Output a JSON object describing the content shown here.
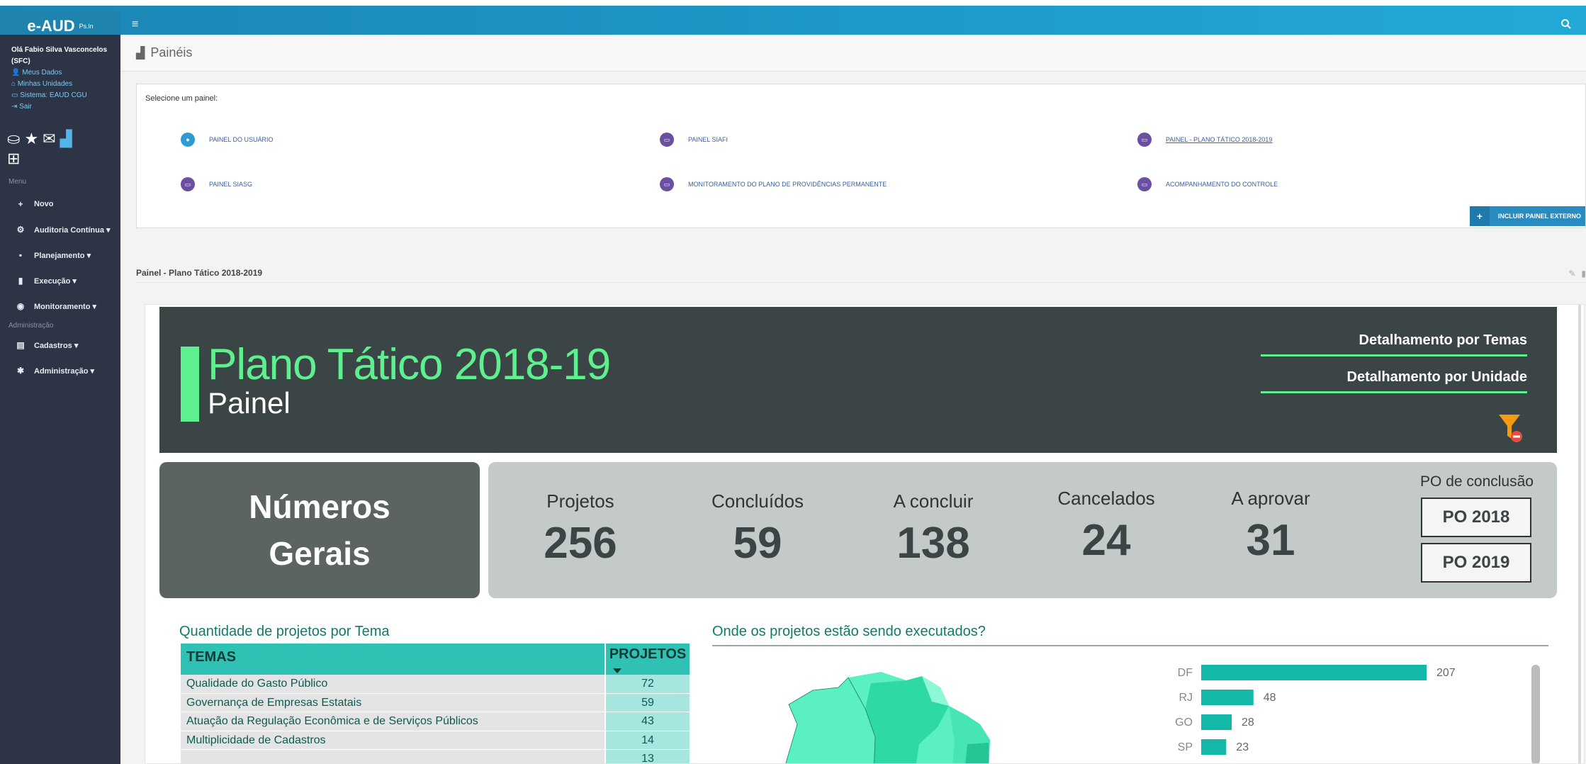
{
  "app": {
    "brand": "e-AUD",
    "brand_suffix": "Ps.ln"
  },
  "user": {
    "greeting": "Olá Fabio Silva Vasconcelos (SFC)",
    "links": [
      "Meus Dados",
      "Minhas Unidades",
      "Sistema: EAUD CGU",
      "Sair"
    ]
  },
  "sidebar": {
    "menu_title": "Menu",
    "items": [
      {
        "icon": "+",
        "label": "Novo"
      },
      {
        "icon": "⚙",
        "label": "Auditoria Contínua ▾"
      },
      {
        "icon": "▪",
        "label": "Planejamento ▾"
      },
      {
        "icon": "▮",
        "label": "Execução ▾"
      },
      {
        "icon": "◉",
        "label": "Monitoramento ▾"
      }
    ],
    "admin_title": "Administração",
    "admin_items": [
      {
        "icon": "▤",
        "label": "Cadastros ▾"
      },
      {
        "icon": "✱",
        "label": "Administração ▾"
      }
    ]
  },
  "page": {
    "title": "Painéis"
  },
  "panel_select": {
    "prompt": "Selecione um painel:",
    "panels": [
      "PAINEL DO USUÁRIO",
      "PAINEL SIAFI",
      "PAINEL - PLANO TÁTICO 2018-2019",
      "PAINEL SIASG",
      "MONITORAMENTO DO PLANO DE PROVIDÊNCIAS PERMANENTE",
      "ACOMPANHAMENTO DO CONTROLE"
    ],
    "add_button": "INCLUIR PAINEL EXTERNO"
  },
  "section": {
    "title": "Painel - Plano Tático 2018-2019"
  },
  "report": {
    "title": "Plano Tático 2018-19",
    "subtitle": "Painel",
    "links": [
      "Detalhamento por Temas",
      "Detalhamento por Unidade"
    ],
    "numeros_gerais_1": "Números",
    "numeros_gerais_2": "Gerais",
    "stats": [
      {
        "label": "Projetos",
        "value": "256"
      },
      {
        "label": "Concluídos",
        "value": "59"
      },
      {
        "label": "A concluir",
        "value": "138"
      },
      {
        "label": "Cancelados",
        "value": "24"
      },
      {
        "label": "A aprovar",
        "value": "31"
      }
    ],
    "po_title": "PO de conclusão",
    "po_buttons": [
      "PO 2018",
      "PO 2019"
    ],
    "table_title": "Quantidade de projetos por Tema",
    "table_headers": [
      "TEMAS",
      "PROJETOS"
    ],
    "table_rows": [
      [
        "Qualidade do Gasto Público",
        "72"
      ],
      [
        "Governança de Empresas Estatais",
        "59"
      ],
      [
        "Atuação da Regulação Econômica e de Serviços Públicos",
        "43"
      ],
      [
        "Multiplicidade de Cadastros",
        "14"
      ],
      [
        "",
        "13"
      ]
    ],
    "map_title": "Onde os projetos estão sendo executados?"
  },
  "chart_data": {
    "type": "bar",
    "orientation": "horizontal",
    "categories": [
      "DF",
      "RJ",
      "GO",
      "SP"
    ],
    "values": [
      207,
      48,
      28,
      23
    ]
  }
}
